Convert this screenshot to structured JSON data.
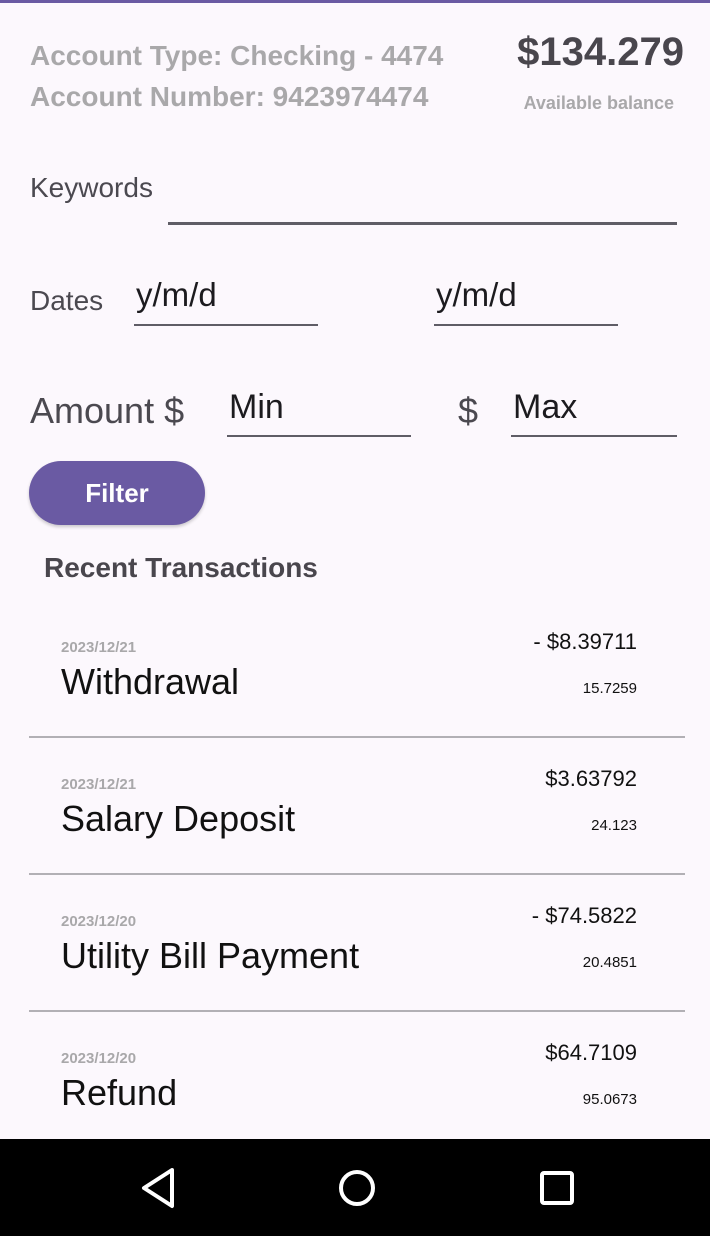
{
  "account": {
    "type_line": "Account Type: Checking - 4474",
    "number_line": "Account Number: 9423974474",
    "balance": "$134.279",
    "balance_label": "Available balance"
  },
  "filters": {
    "keywords_label": "Keywords",
    "keywords_value": "",
    "dates_label": "Dates",
    "date_start_placeholder": "y/m/d",
    "date_end_placeholder": "y/m/d",
    "amount_label": "Amount $",
    "amount_min_placeholder": "Min",
    "amount_max_currency": "$",
    "amount_max_placeholder": "Max",
    "filter_button": "Filter"
  },
  "transactions": {
    "title": "Recent Transactions",
    "items": [
      {
        "date": "2023/12/21",
        "name": "Withdrawal",
        "amount": "- $8.39711",
        "sub": "15.7259"
      },
      {
        "date": "2023/12/21",
        "name": "Salary Deposit",
        "amount": "$3.63792",
        "sub": "24.123"
      },
      {
        "date": "2023/12/20",
        "name": "Utility Bill Payment",
        "amount": "- $74.5822",
        "sub": "20.4851"
      },
      {
        "date": "2023/12/20",
        "name": "Refund",
        "amount": "$64.7109",
        "sub": "95.0673"
      }
    ]
  },
  "colors": {
    "accent": "#6a5aa3",
    "background": "#fcf8fd",
    "muted_text": "#a9a8aa",
    "nav_bar": "#000000"
  },
  "nav": {
    "back_icon": "back-triangle-icon",
    "home_icon": "home-circle-icon",
    "recents_icon": "recents-square-icon"
  }
}
